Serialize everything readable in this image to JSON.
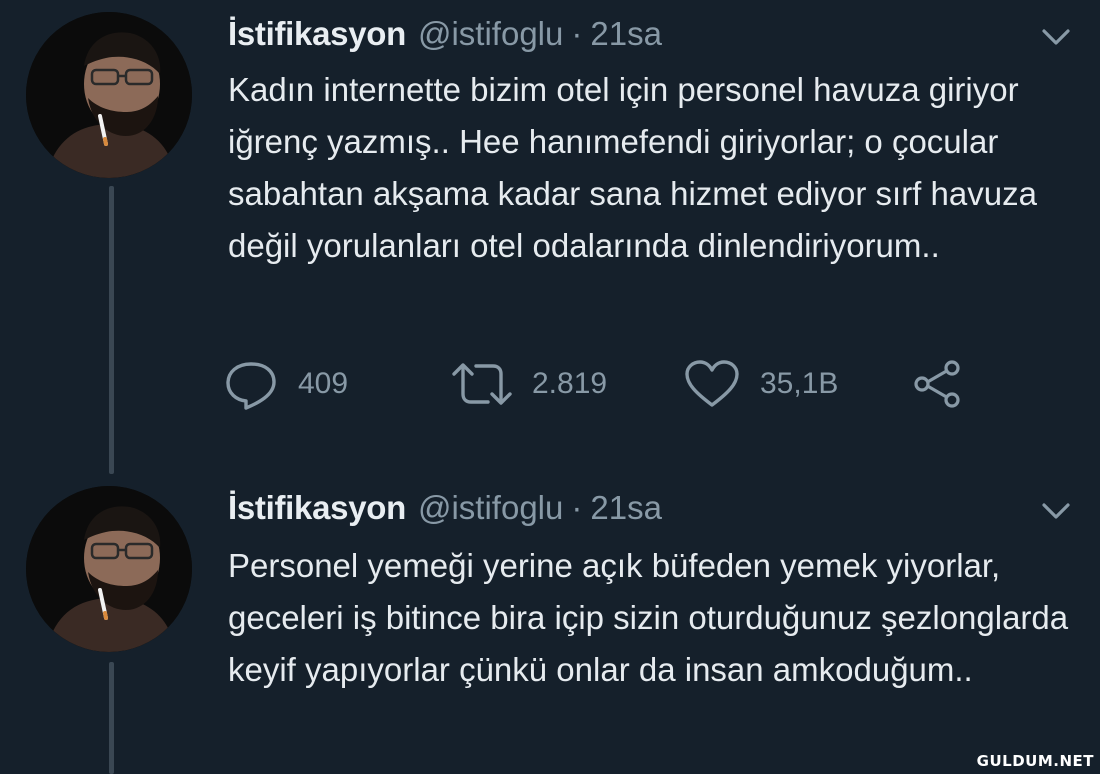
{
  "tweets": [
    {
      "author_name": "İstifikasyon",
      "handle": "@istifoglu",
      "separator": "·",
      "time": "21sa",
      "text": "Kadın internette bizim otel için personel havuza giriyor iğrenç yazmış.. Hee hanımefendi giriyorlar; o çocular sabahtan akşama kadar sana hizmet ediyor sırf havuza değil yorulanları otel odalarında dinlendiriyorum..",
      "actions": {
        "replies": "409",
        "retweets": "2.819",
        "likes": "35,1B"
      }
    },
    {
      "author_name": "İstifikasyon",
      "handle": "@istifoglu",
      "separator": "·",
      "time": "21sa",
      "text": "Personel yemeği yerine açık büfeden yemek yiyorlar, geceleri iş bitince bira içip sizin oturduğunuz şezlonglarda keyif yapıyorlar çünkü onlar da insan amkoduğum.."
    }
  ],
  "watermark": "GULDUM.NET",
  "icons": {
    "reply": "reply-icon",
    "retweet": "retweet-icon",
    "like": "heart-icon",
    "share": "share-icon",
    "menu": "chevron-down-icon"
  },
  "colors": {
    "background": "#15202b",
    "text": "#e6ebef",
    "secondary": "#8899a6",
    "thread_line": "#3a4753"
  }
}
